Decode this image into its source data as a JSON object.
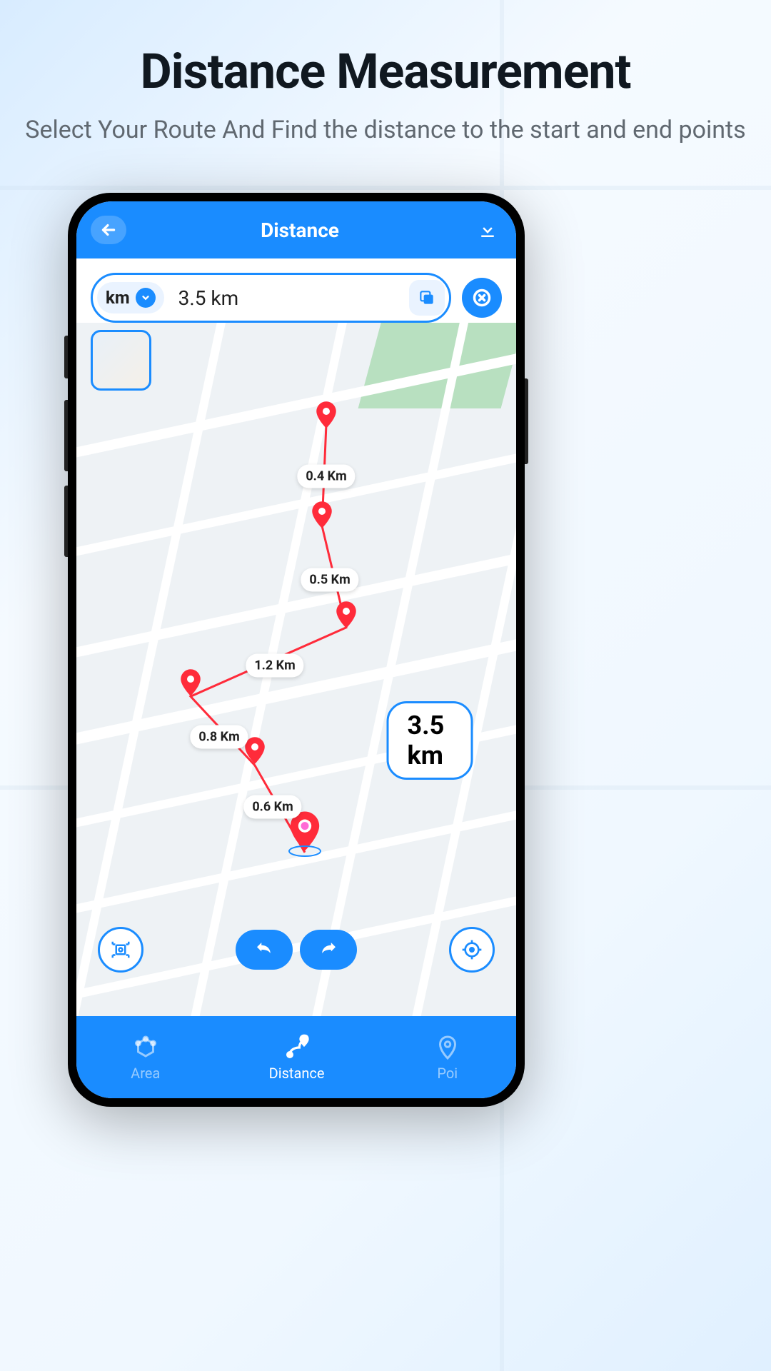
{
  "page": {
    "title": "Distance Measurement",
    "subtitle": "Select Your Route And  Find the distance to the start and end points"
  },
  "appbar": {
    "title": "Distance"
  },
  "unit": {
    "label": "km"
  },
  "distance": {
    "value": "3.5 km",
    "total_badge": "3.5 km"
  },
  "segments": {
    "s1": "0.4 Km",
    "s2": "0.5 Km",
    "s3": "1.2 Km",
    "s4": "0.8 Km",
    "s5": "0.6 Km"
  },
  "nav": {
    "area": "Area",
    "distance": "Distance",
    "poi": "Poi"
  },
  "colors": {
    "primary": "#1a8cff",
    "marker": "#ff2b3a"
  }
}
